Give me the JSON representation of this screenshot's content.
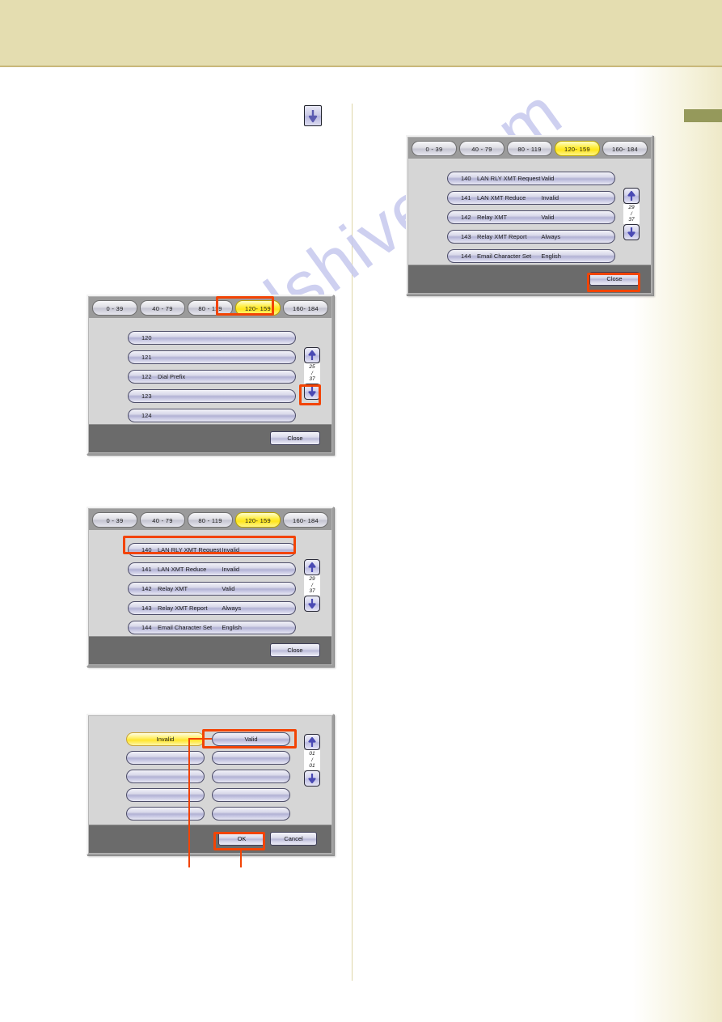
{
  "page": {
    "watermark": "manualshive.com",
    "accent_highlight": "#f24405",
    "header_band_color": "#e4ddb0",
    "side_tab_color": "#95995b"
  },
  "inline_arrow": {
    "icon": "arrow-down-icon"
  },
  "tabs": [
    "0  - 39",
    "40 - 79",
    "80 - 119",
    "120- 159",
    "160- 184"
  ],
  "active_tab_index": 3,
  "panels": [
    {
      "id": "panel-fax-params-120",
      "tabs": [
        "0  - 39",
        "40 - 79",
        "80 - 119",
        "120- 159",
        "160- 184"
      ],
      "active_tab": "120- 159",
      "rows": [
        {
          "num": "120",
          "name": "",
          "value": ""
        },
        {
          "num": "121",
          "name": "",
          "value": ""
        },
        {
          "num": "122",
          "name": "Dial Prefix",
          "value": ""
        },
        {
          "num": "123",
          "name": "",
          "value": ""
        },
        {
          "num": "124",
          "name": "",
          "value": ""
        }
      ],
      "scroll": {
        "up": "scroll-up-icon",
        "down": "scroll-down-icon",
        "current": "25",
        "separator": "/",
        "total": "37"
      },
      "footer_button": "Close"
    },
    {
      "id": "panel-fax-params-140",
      "tabs": [
        "0  - 39",
        "40 - 79",
        "80 - 119",
        "120- 159",
        "160- 184"
      ],
      "active_tab": "120- 159",
      "rows": [
        {
          "num": "140",
          "name": "LAN RLY XMT Request",
          "value": "Invalid"
        },
        {
          "num": "141",
          "name": "LAN XMT Reduce",
          "value": "Invalid"
        },
        {
          "num": "142",
          "name": "Relay XMT",
          "value": "Valid"
        },
        {
          "num": "143",
          "name": "Relay XMT Report",
          "value": "Always"
        },
        {
          "num": "144",
          "name": "Email Character Set",
          "value": "English"
        }
      ],
      "scroll": {
        "up": "scroll-up-icon",
        "down": "scroll-down-icon",
        "current": "29",
        "separator": "/",
        "total": "37"
      },
      "footer_button": "Close"
    },
    {
      "id": "panel-select-value",
      "options_left": [
        "Invalid",
        "",
        "",
        "",
        ""
      ],
      "options_right": [
        "Valid",
        "",
        "",
        "",
        ""
      ],
      "selected_option": "Invalid",
      "highlighted_option": "Valid",
      "scroll": {
        "up": "scroll-up-icon",
        "down": "scroll-down-icon",
        "current": "01",
        "separator": "/",
        "total": "01"
      },
      "footer_buttons": [
        "OK",
        "Cancel"
      ]
    },
    {
      "id": "panel-fax-params-140-valid",
      "tabs": [
        "0  - 39",
        "40 - 79",
        "80 - 119",
        "120- 159",
        "160- 184"
      ],
      "active_tab": "120- 159",
      "rows": [
        {
          "num": "140",
          "name": "LAN RLY XMT Request",
          "value": "Valid"
        },
        {
          "num": "141",
          "name": "LAN XMT Reduce",
          "value": "Invalid"
        },
        {
          "num": "142",
          "name": "Relay XMT",
          "value": "Valid"
        },
        {
          "num": "143",
          "name": "Relay XMT Report",
          "value": "Always"
        },
        {
          "num": "144",
          "name": "Email Character Set",
          "value": "English"
        }
      ],
      "scroll": {
        "up": "scroll-up-icon",
        "down": "scroll-down-icon",
        "current": "29",
        "separator": "/",
        "total": "37"
      },
      "footer_button": "Close"
    }
  ]
}
